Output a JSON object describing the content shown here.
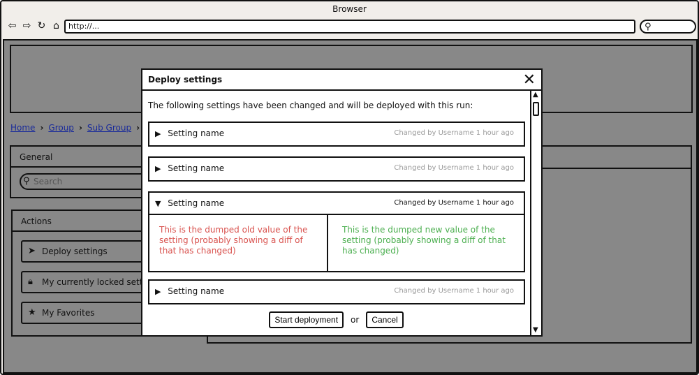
{
  "browser": {
    "title": "Browser",
    "url": "http://...",
    "nav_icons": [
      "back-arrow-icon",
      "forward-arrow-icon",
      "reload-icon",
      "home-icon"
    ]
  },
  "breadcrumb": [
    "Home",
    "Group",
    "Sub Group"
  ],
  "general": {
    "title": "General",
    "search_placeholder": "Search"
  },
  "actions": {
    "title": "Actions",
    "items": [
      {
        "label": "Deploy settings",
        "icon": "send-icon"
      },
      {
        "label": "My currently locked settings",
        "icon": "lock-icon"
      },
      {
        "label": "My Favorites",
        "icon": "star-icon"
      }
    ]
  },
  "modal": {
    "title": "Deploy settings",
    "intro": "The following settings have been changed and will be deployed with this run:",
    "settings": [
      {
        "name": "Setting name",
        "meta": "Changed by Username 1 hour ago",
        "expanded": false
      },
      {
        "name": "Setting name",
        "meta": "Changed by Username 1 hour ago",
        "expanded": false
      },
      {
        "name": "Setting name",
        "meta": "Changed by Username 1 hour ago",
        "expanded": true,
        "old_value": "This is the dumped old value of the setting (probably showing a diff of that has changed)",
        "new_value": "This is the dumped new value of the setting (probably showing a diff of that has changed)"
      },
      {
        "name": "Setting name",
        "meta": "Changed by Username 1 hour ago",
        "expanded": false
      }
    ],
    "start_label": "Start deployment",
    "or_label": "or",
    "cancel_label": "Cancel"
  },
  "colors": {
    "old": "#d9534f",
    "new": "#4caf50",
    "overlay": "#888888"
  }
}
